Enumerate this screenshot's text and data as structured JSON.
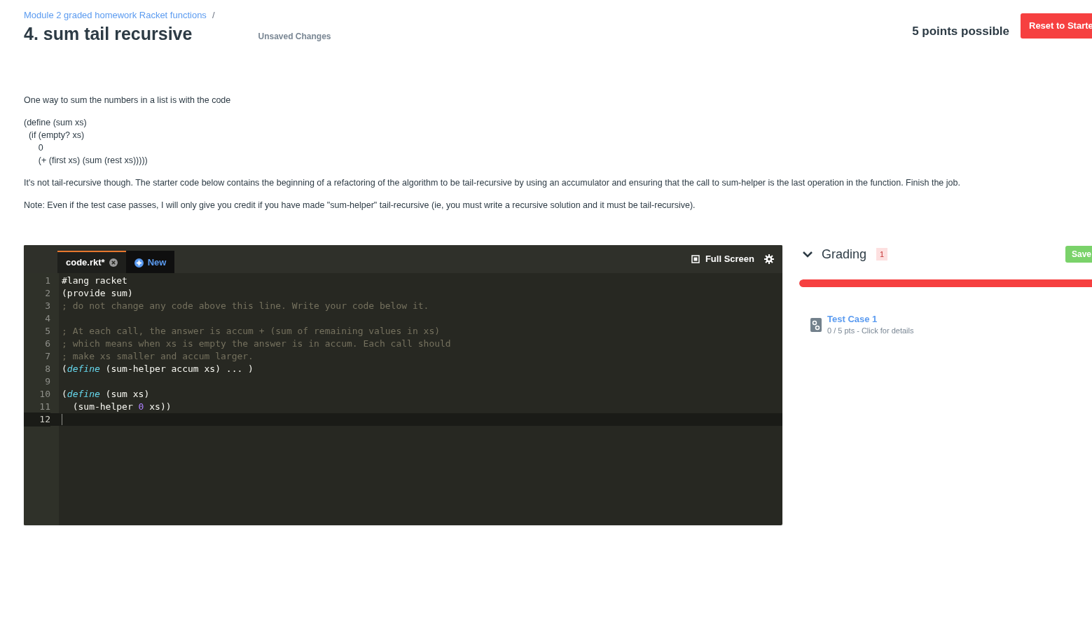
{
  "breadcrumb": {
    "link": "Module 2 graded homework Racket functions",
    "separator": "/"
  },
  "title": "4. sum tail recursive",
  "save_status": "Unsaved Changes",
  "points": "5 points possible",
  "reset_button": "Reset to Starte",
  "description": [
    {
      "kind": "para",
      "text": "One way to sum the numbers in a list is with the code"
    },
    {
      "kind": "code",
      "lines": [
        "(define (sum xs)",
        "  (if (empty? xs)",
        "      0",
        "      (+ (first xs) (sum (rest xs)))))"
      ]
    },
    {
      "kind": "para",
      "text": "It's not tail-recursive though. The starter code below contains the beginning of a refactoring of the algorithm to be tail-recursive by using an accumulator and ensuring that the call to sum-helper is the last operation in the function. Finish the job."
    },
    {
      "kind": "para",
      "text": "Note: Even if the test case passes, I will only give you credit if you have made \"sum-helper\" tail-recursive (ie, you must write a recursive solution and it must be tail-recursive)."
    }
  ],
  "editor": {
    "tabs": [
      {
        "label": "code.rkt*",
        "kind": "file",
        "selected": true
      },
      {
        "label": "New",
        "kind": "new",
        "selected": false
      }
    ],
    "full_screen": "Full Screen",
    "lines": [
      {
        "number": "1",
        "current": false,
        "tokens": [
          {
            "kind": "plain",
            "text": "#lang racket"
          }
        ]
      },
      {
        "number": "2",
        "current": false,
        "tokens": [
          {
            "kind": "plain",
            "text": "(provide sum)"
          }
        ]
      },
      {
        "number": "3",
        "current": false,
        "tokens": [
          {
            "kind": "comment",
            "text": "; do not change any code above this line. Write your code below it."
          }
        ]
      },
      {
        "number": "4",
        "current": false
      },
      {
        "number": "5",
        "current": false,
        "tokens": [
          {
            "kind": "comment",
            "text": "; At each call, the answer is accum + (sum of remaining values in xs)"
          }
        ]
      },
      {
        "number": "6",
        "current": false,
        "tokens": [
          {
            "kind": "comment",
            "text": "; which means when xs is empty the answer is in accum. Each call should"
          }
        ]
      },
      {
        "number": "7",
        "current": false,
        "tokens": [
          {
            "kind": "comment",
            "text": "; make xs smaller and accum larger."
          }
        ]
      },
      {
        "number": "8",
        "current": false,
        "tokens": [
          {
            "kind": "plain",
            "text": "("
          },
          {
            "kind": "keyword",
            "text": "define"
          },
          {
            "kind": "plain",
            "text": " (sum-helper accum xs) ... )"
          }
        ]
      },
      {
        "number": "9",
        "current": false
      },
      {
        "number": "10",
        "current": false,
        "tokens": [
          {
            "kind": "plain",
            "text": "("
          },
          {
            "kind": "keyword",
            "text": "define"
          },
          {
            "kind": "plain",
            "text": " (sum xs)"
          }
        ]
      },
      {
        "number": "11",
        "current": false,
        "tokens": [
          {
            "kind": "plain",
            "text": "  (sum-helper "
          },
          {
            "kind": "number",
            "text": "0"
          },
          {
            "kind": "plain",
            "text": " xs))"
          }
        ]
      },
      {
        "number": "12",
        "current": true
      }
    ]
  },
  "grading": {
    "title": "Grading",
    "count": "1",
    "save_button": "Save",
    "progress": {
      "level": 1
    },
    "tests": [
      {
        "name": "Test Case 1",
        "detail": "0 / 5 pts - Click for details"
      }
    ]
  }
}
